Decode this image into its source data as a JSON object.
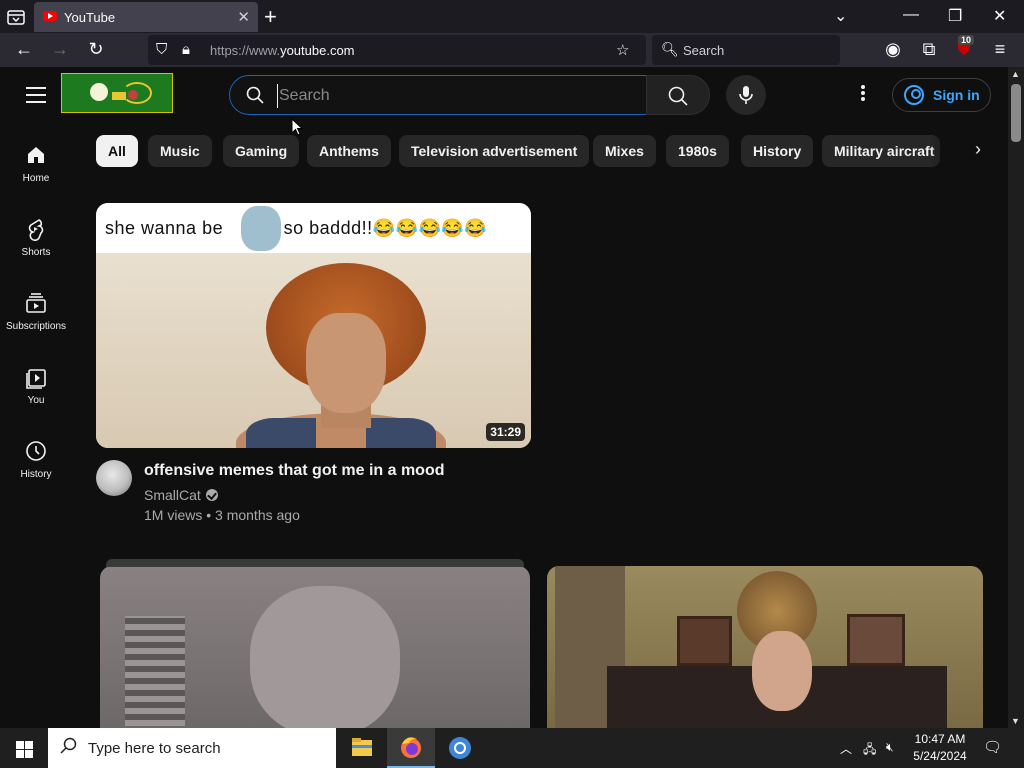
{
  "browser": {
    "tab_title": "YouTube",
    "url_prefix": "https://www.",
    "url_host": "youtube.com",
    "search_label": "Search",
    "extensions_badge": "10"
  },
  "header": {
    "search_placeholder": "Search",
    "sign_in_label": "Sign in"
  },
  "sidebar": {
    "items": [
      {
        "label": "Home",
        "icon": "home-icon"
      },
      {
        "label": "Shorts",
        "icon": "shorts-icon"
      },
      {
        "label": "Subscriptions",
        "icon": "subscriptions-icon"
      },
      {
        "label": "You",
        "icon": "you-icon"
      },
      {
        "label": "History",
        "icon": "history-icon"
      }
    ]
  },
  "chips": [
    "All",
    "Music",
    "Gaming",
    "Anthems",
    "Television advertisement",
    "Mixes",
    "1980s",
    "History",
    "Military aircraft"
  ],
  "videos": [
    {
      "thumb_caption": "she wanna be",
      "thumb_caption2": "so baddd!!😂😂😂😂😂",
      "duration": "31:29",
      "title": "offensive memes that got me in a mood",
      "channel": "SmallCat",
      "meta": "1M views • 3 months ago"
    }
  ],
  "taskbar": {
    "search_placeholder": "Type here to search",
    "time": "10:47 AM",
    "date": "5/24/2024"
  },
  "colors": {
    "accent_blue": "#3ea6ff",
    "background": "#0f0f0f",
    "chip_bg": "#272727"
  }
}
